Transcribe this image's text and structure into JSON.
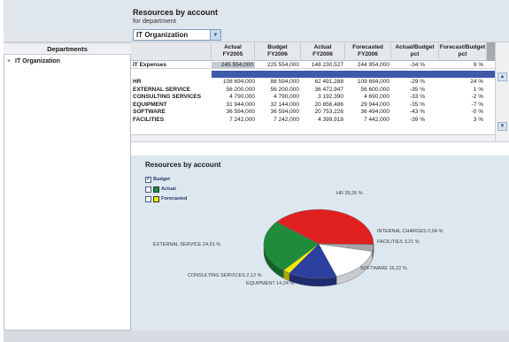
{
  "report": {
    "title": "Resources by account",
    "subtitle": "for department"
  },
  "department_select": {
    "value": "IT Organization"
  },
  "departments": {
    "header": "Departments",
    "tree_item": "IT Organization",
    "tree_expander": "+"
  },
  "table": {
    "columns": [
      {
        "line1": "Actual",
        "line2": "FY2005"
      },
      {
        "line1": "Budget",
        "line2": "FY2006"
      },
      {
        "line1": "Actual",
        "line2": "FY2006"
      },
      {
        "line1": "Forecasted",
        "line2": "FY2006"
      },
      {
        "line1": "Actual/Budget",
        "line2": "pct"
      },
      {
        "line1": "Forecast/Budget",
        "line2": "pct"
      }
    ],
    "total_row": {
      "label": "IT Expenses",
      "values": [
        "245 554,000",
        "225 554,000",
        "148 230,527",
        "244 954,000",
        "-34 %",
        "9 %"
      ]
    },
    "rows": [
      {
        "label": "HR",
        "values": [
          "108 694,000",
          "88 594,000",
          "62 491,288",
          "109 694,000",
          "-29 %",
          "24 %"
        ]
      },
      {
        "label": "EXTERNAL SERVICE",
        "values": [
          "56 200,000",
          "56 200,000",
          "36 472,947",
          "56 600,000",
          "-35 %",
          "1 %"
        ]
      },
      {
        "label": "CONSULTING SERVICES",
        "values": [
          "4 790,000",
          "4 790,000",
          "3 192,390",
          "4 690,000",
          "-33 %",
          "-2 %"
        ]
      },
      {
        "label": "EQUIPMENT",
        "values": [
          "31 944,000",
          "32 144,000",
          "20 856,486",
          "29 944,000",
          "-35 %",
          "-7 %"
        ]
      },
      {
        "label": "SOFTWARE",
        "values": [
          "36 594,000",
          "36 594,000",
          "20 753,226",
          "36 494,000",
          "-43 %",
          "-0 %"
        ]
      },
      {
        "label": "FACILITIES",
        "values": [
          "7 242,000",
          "7 242,000",
          "4 399,918",
          "7 442,000",
          "-39 %",
          "3 %"
        ]
      }
    ]
  },
  "chart": {
    "title": "Resources by account",
    "legend": [
      {
        "label": "Budget",
        "checked": true,
        "color": "#ffffff"
      },
      {
        "label": "Actual",
        "checked": false,
        "color": "#1e8c3a"
      },
      {
        "label": "Forecasted",
        "checked": false,
        "color": "#f2ea00"
      }
    ]
  },
  "chart_data": {
    "type": "pie",
    "title": "Resources by account",
    "series_name": "Budget",
    "slices": [
      {
        "label": "HR",
        "value": 39.26,
        "display": "HR 39,26 %",
        "color": "#e02020"
      },
      {
        "label": "INTERNAL CHARGES",
        "value": 0.04,
        "display": "INTERNAL CHARGES 0,04 %",
        "color": "#8a8a8a"
      },
      {
        "label": "FACILITIES",
        "value": 3.21,
        "display": "FACILITIES 3,21 %",
        "color": "#a6a6a6"
      },
      {
        "label": "SOFTWARE",
        "value": 16.22,
        "display": "SOFTWARE 16,22 %",
        "color": "#ffffff"
      },
      {
        "label": "EQUIPMENT",
        "value": 14.24,
        "display": "EQUIPMENT 14,24 %",
        "color": "#2b3f9e"
      },
      {
        "label": "CONSULTING SERVICES",
        "value": 2.12,
        "display": "CONSULTING SERVICES 2,12 %",
        "color": "#f2ea00"
      },
      {
        "label": "EXTERNAL SERVICE",
        "value": 24.91,
        "display": "EXTERNAL SERVICE 24,91 %",
        "color": "#1e8c3a"
      }
    ]
  }
}
